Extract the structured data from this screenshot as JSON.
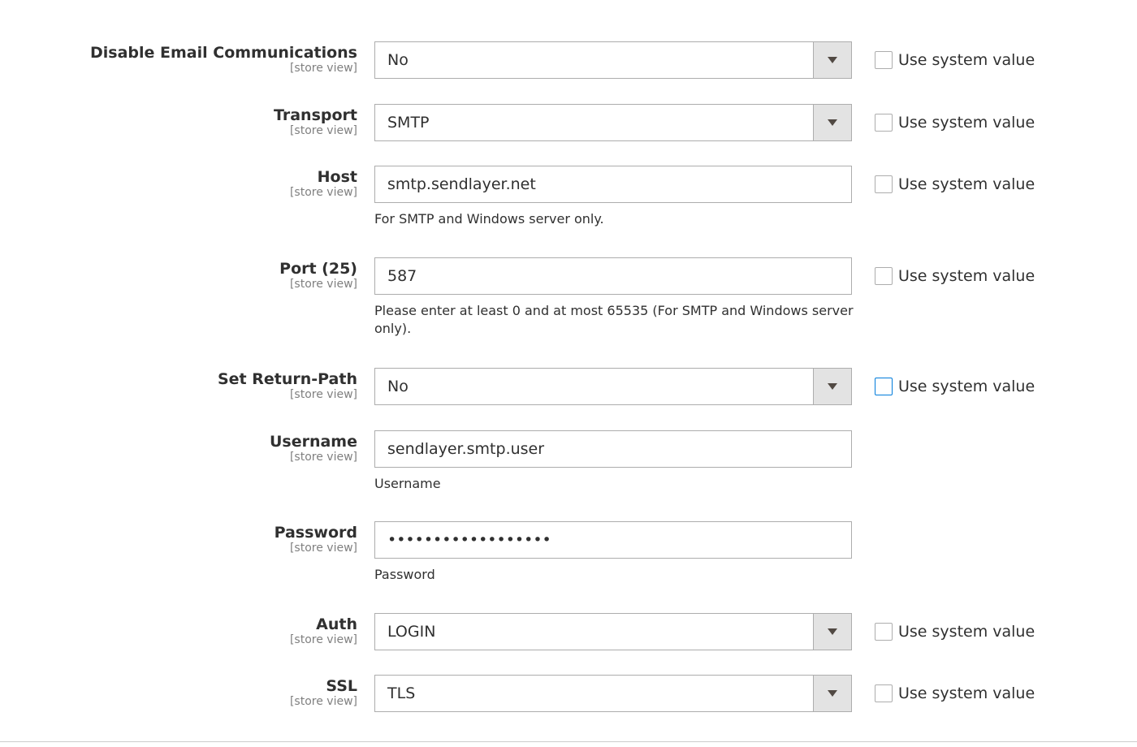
{
  "fields": {
    "disable_email": {
      "label": "Disable Email Communications",
      "scope": "[store view]",
      "value": "No",
      "use_system_value": "Use system value"
    },
    "transport": {
      "label": "Transport",
      "scope": "[store view]",
      "value": "SMTP",
      "use_system_value": "Use system value"
    },
    "host": {
      "label": "Host",
      "scope": "[store view]",
      "value": "smtp.sendlayer.net",
      "note": "For SMTP and Windows server only.",
      "use_system_value": "Use system value"
    },
    "port": {
      "label": "Port (25)",
      "scope": "[store view]",
      "value": "587",
      "note": "Please enter at least 0 and at most 65535 (For SMTP and Windows server only).",
      "use_system_value": "Use system value"
    },
    "return_path": {
      "label": "Set Return-Path",
      "scope": "[store view]",
      "value": "No",
      "use_system_value": "Use system value"
    },
    "username": {
      "label": "Username",
      "scope": "[store view]",
      "value": "sendlayer.smtp.user",
      "note": "Username"
    },
    "password": {
      "label": "Password",
      "scope": "[store view]",
      "value": "••••••••••••••••••",
      "note": "Password"
    },
    "auth": {
      "label": "Auth",
      "scope": "[store view]",
      "value": "LOGIN",
      "use_system_value": "Use system value"
    },
    "ssl": {
      "label": "SSL",
      "scope": "[store view]",
      "value": "TLS",
      "use_system_value": "Use system value"
    }
  },
  "colors": {
    "border": "#adadad",
    "select_button": "#e3e3e3",
    "focus": "#007bdb",
    "text": "#303030",
    "scope_text": "#808080"
  }
}
